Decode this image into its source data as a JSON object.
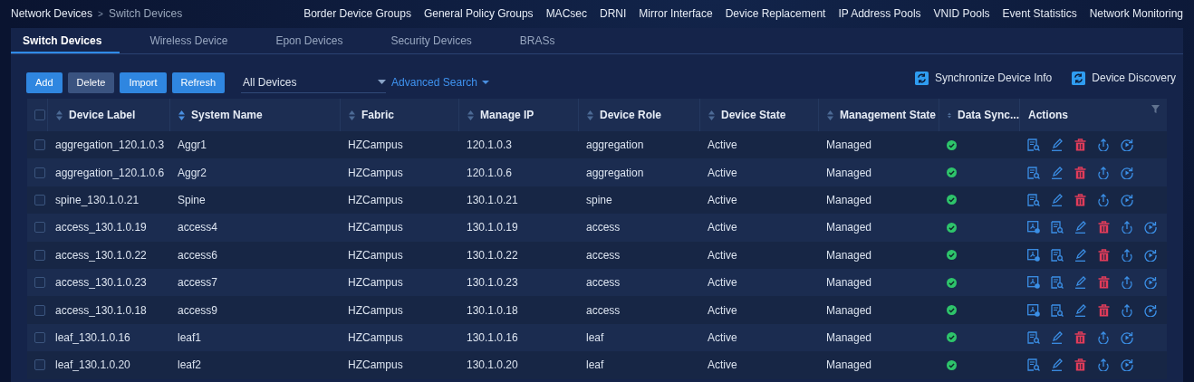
{
  "breadcrumb": [
    "Network Devices",
    ">",
    "Switch Devices"
  ],
  "top_links": [
    "Border Device Groups",
    "General Policy Groups",
    "MACsec",
    "DRNI",
    "Mirror Interface",
    "Device Replacement",
    "IP Address Pools",
    "VNID Pools",
    "Event Statistics",
    "Network Monitoring"
  ],
  "tabs": [
    {
      "label": "Switch Devices",
      "selected": true
    },
    {
      "label": "Wireless Device",
      "selected": false
    },
    {
      "label": "Epon Devices",
      "selected": false
    },
    {
      "label": "Security Devices",
      "selected": false
    },
    {
      "label": "BRASs",
      "selected": false
    }
  ],
  "buttons": [
    {
      "label": "Add",
      "kind": "primary"
    },
    {
      "label": "Delete",
      "kind": "muted"
    },
    {
      "label": "Import",
      "kind": "primary"
    },
    {
      "label": "Refresh",
      "kind": "primary"
    }
  ],
  "device_filter": {
    "value": "All Devices"
  },
  "advanced_search": "Advanced Search",
  "right_actions": [
    "Synchronize Device Info",
    "Device Discovery"
  ],
  "table": {
    "select_all_checked": false,
    "columns": [
      "Device Label",
      "System Name",
      "Fabric",
      "Manage IP",
      "Device Role",
      "Device State",
      "Management State",
      "Data Sync...",
      "Actions"
    ],
    "rows": [
      {
        "checked": false,
        "cells": [
          "aggregation_120.1.0.3",
          "Aggr1",
          "HZCampus",
          "120.1.0.3",
          "aggregation",
          "Active",
          "Managed"
        ],
        "synced": true,
        "topology_action": false
      },
      {
        "checked": false,
        "cells": [
          "aggregation_120.1.0.6",
          "Aggr2",
          "HZCampus",
          "120.1.0.6",
          "aggregation",
          "Active",
          "Managed"
        ],
        "synced": true,
        "topology_action": false
      },
      {
        "checked": false,
        "cells": [
          "spine_130.1.0.21",
          "Spine",
          "HZCampus",
          "130.1.0.21",
          "spine",
          "Active",
          "Managed"
        ],
        "synced": true,
        "topology_action": false
      },
      {
        "checked": false,
        "cells": [
          "access_130.1.0.19",
          "access4",
          "HZCampus",
          "130.1.0.19",
          "access",
          "Active",
          "Managed"
        ],
        "synced": true,
        "topology_action": true
      },
      {
        "checked": false,
        "cells": [
          "access_130.1.0.22",
          "access6",
          "HZCampus",
          "130.1.0.22",
          "access",
          "Active",
          "Managed"
        ],
        "synced": true,
        "topology_action": true
      },
      {
        "checked": false,
        "cells": [
          "access_130.1.0.23",
          "access7",
          "HZCampus",
          "130.1.0.23",
          "access",
          "Active",
          "Managed"
        ],
        "synced": true,
        "topology_action": true
      },
      {
        "checked": false,
        "cells": [
          "access_130.1.0.18",
          "access9",
          "HZCampus",
          "130.1.0.18",
          "access",
          "Active",
          "Managed"
        ],
        "synced": true,
        "topology_action": true
      },
      {
        "checked": false,
        "cells": [
          "leaf_130.1.0.16",
          "leaf1",
          "HZCampus",
          "130.1.0.16",
          "leaf",
          "Active",
          "Managed"
        ],
        "synced": true,
        "topology_action": false
      },
      {
        "checked": false,
        "cells": [
          "leaf_130.1.0.20",
          "leaf2",
          "HZCampus",
          "130.1.0.20",
          "leaf",
          "Active",
          "Managed"
        ],
        "synced": true,
        "topology_action": false
      }
    ]
  }
}
